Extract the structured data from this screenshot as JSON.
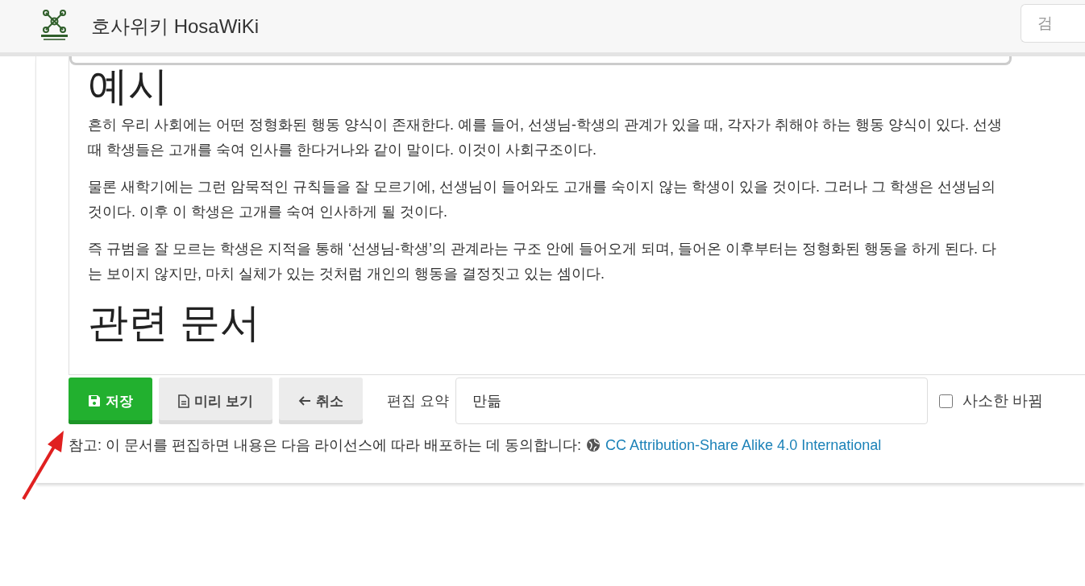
{
  "header": {
    "site_title": "호사위키 HosaWiKi",
    "search": {
      "placeholder": "검"
    }
  },
  "editor": {
    "blocks": [
      {
        "kind": "heading",
        "text": "예시"
      },
      {
        "kind": "paragraph",
        "lines": [
          "흔히 우리 사회에는 어떤 정형화된 행동 양식이 존재한다. 예를 들어, 선생님-학생의 관계가 있을 때, 각자가 취해야 하는 행동 양식이 있다. 선생",
          "때 학생들은 고개를 숙여 인사를 한다거나와 같이 말이다. 이것이 사회구조이다."
        ]
      },
      {
        "kind": "paragraph",
        "lines": [
          "물론 새학기에는 그런 암묵적인 규칙들을 잘 모르기에, 선생님이 들어와도 고개를 숙이지 않는 학생이 있을 것이다. 그러나 그 학생은 선생님의",
          "것이다. 이후 이 학생은 고개를 숙여 인사하게 될 것이다."
        ]
      },
      {
        "kind": "paragraph",
        "lines": [
          "즉 규범을 잘 모르는 학생은 지적을 통해 ‘선생님-학생’의 관계라는 구조 안에 들어오게 되며, 들어온 이후부터는 정형화된 행동을 하게 된다. 다",
          "는 보이지 않지만, 마치 실체가 있는 것처럼 개인의 행동을 결정짓고 있는 셈이다."
        ]
      },
      {
        "kind": "heading",
        "text": "관련 문서"
      }
    ]
  },
  "actions": {
    "buttons": [
      {
        "kind": "save",
        "label": "저장"
      },
      {
        "kind": "preview",
        "label": "미리 보기"
      },
      {
        "kind": "cancel",
        "label": "취소"
      }
    ],
    "summary_label": "편집 요약",
    "summary_value": "만듦",
    "minor_edit": {
      "label": "사소한 바뀜",
      "checked": false
    }
  },
  "license_note": {
    "text": "참고: 이 문서를 편집하면 내용은 다음 라이선스에 따라 배포하는 데 동의합니다:",
    "link": "CC Attribution-Share Alike 4.0 International"
  }
}
